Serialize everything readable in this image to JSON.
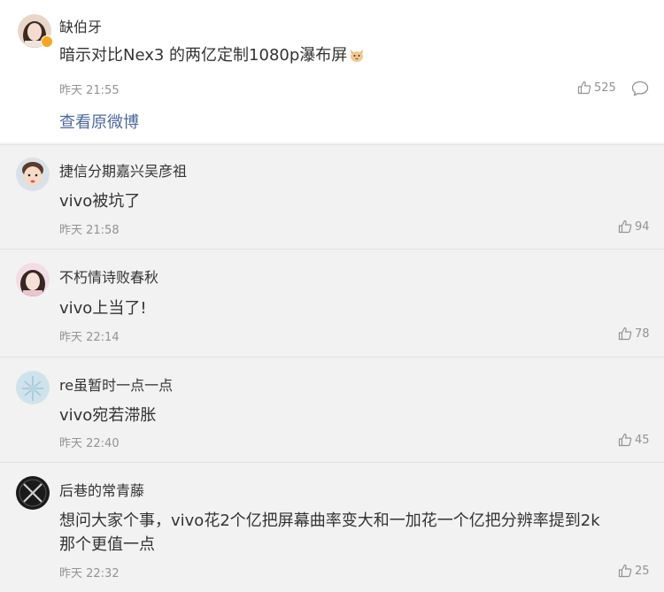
{
  "original_post": {
    "author": "缺伯牙",
    "text": "暗示对比Nex3 的两亿定制1080p瀑布屏",
    "time": "昨天 21:55",
    "likes": "525",
    "view_original": "查看原微博"
  },
  "comments": [
    {
      "author": "捷信分期嘉兴吴彦祖",
      "text": "vivo被坑了",
      "time": "昨天 21:58",
      "likes": "94"
    },
    {
      "author": "不朽情诗败春秋",
      "text": "vivo上当了!",
      "time": "昨天 22:14",
      "likes": "78"
    },
    {
      "author": "re虽暂时一点一点",
      "text": "vivo宛若滞胀",
      "time": "昨天 22:40",
      "likes": "45"
    },
    {
      "author": "后巷的常青藤",
      "text_line1": "想问大家个事，vivo花2个亿把屏幕曲率变大和一加花一个亿把分辨率提到2k",
      "text_line2": "那个更值一点",
      "time": "昨天 22:32",
      "likes": "25"
    }
  ],
  "colors": {
    "link": "#4d6a9e",
    "meta": "#939393",
    "background": "#f2f2f2",
    "verified": "#f6a623"
  }
}
